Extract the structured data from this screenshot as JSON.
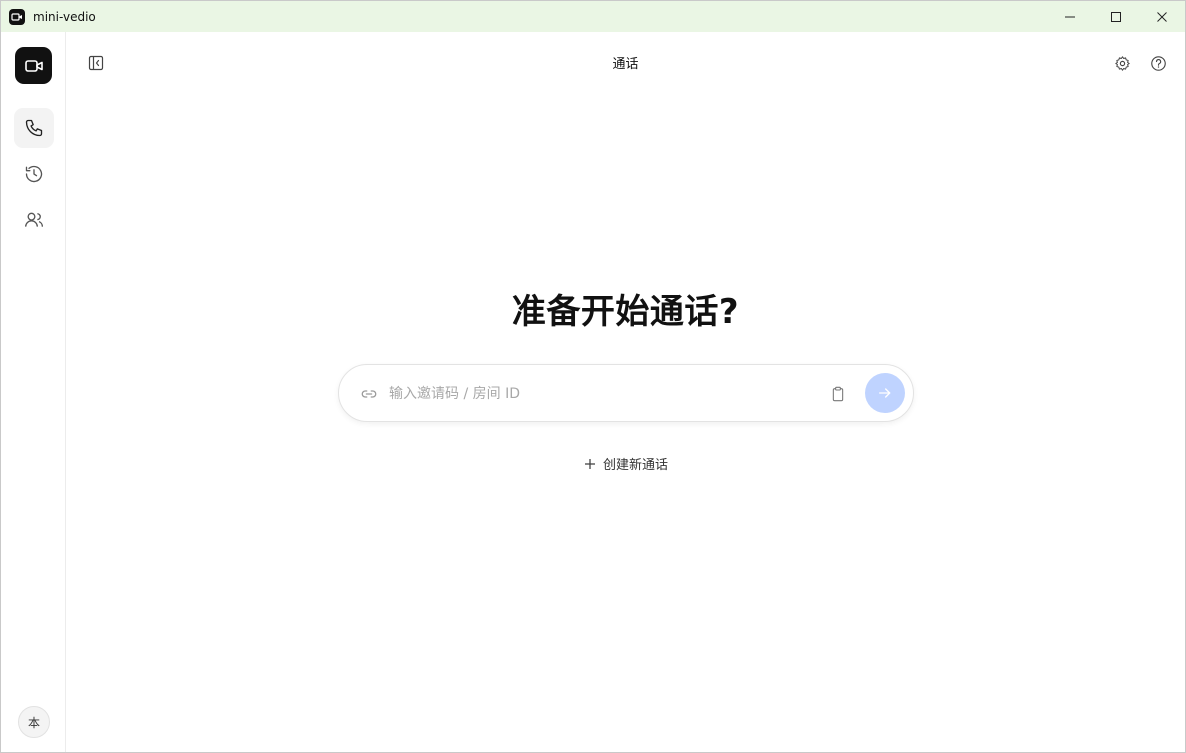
{
  "window": {
    "title": "mini-vedio"
  },
  "sidebar": {
    "items": [
      {
        "name": "phone",
        "icon": "phone-icon",
        "active": true
      },
      {
        "name": "history",
        "icon": "history-icon",
        "active": false
      },
      {
        "name": "contacts",
        "icon": "users-icon",
        "active": false
      }
    ],
    "avatar_label": "本"
  },
  "header": {
    "title": "通话"
  },
  "main": {
    "headline": "准备开始通话?",
    "input_placeholder": "输入邀请码 / 房间 ID",
    "create_label": "创建新通话"
  },
  "colors": {
    "titlebar_bg": "#eaf6e4",
    "accent_button": "#bfd3ff",
    "logo_bg": "#111111"
  }
}
